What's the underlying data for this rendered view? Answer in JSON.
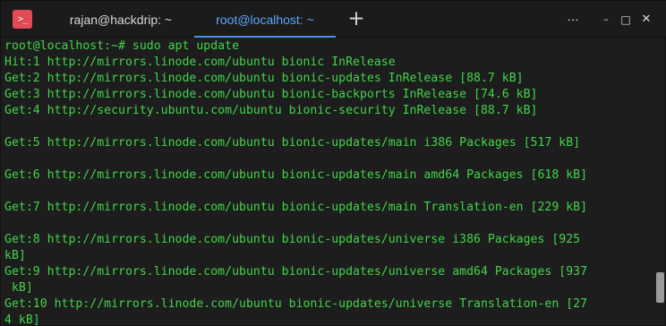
{
  "window": {
    "title_tabs": [
      {
        "label": "rajan@hackdrip: ~",
        "active": false
      },
      {
        "label": "root@localhost: ~",
        "active": true
      }
    ],
    "app_icon": "terminal-icon",
    "icon_glyph": ">_",
    "controls": {
      "new_tab": "+",
      "menu": "⋮",
      "minimize": "–",
      "maximize": "□",
      "close": "✕"
    },
    "colors": {
      "background": "#1d1d1d",
      "terminal_text": "#44d34b",
      "active_tab": "#5aa6ff",
      "app_icon": "#e34a55"
    }
  },
  "terminal": {
    "lines": [
      "root@localhost:~# sudo apt update",
      "Hit:1 http://mirrors.linode.com/ubuntu bionic InRelease",
      "Get:2 http://mirrors.linode.com/ubuntu bionic-updates InRelease [88.7 kB]",
      "Get:3 http://mirrors.linode.com/ubuntu bionic-backports InRelease [74.6 kB]",
      "Get:4 http://security.ubuntu.com/ubuntu bionic-security InRelease [88.7 kB]",
      "",
      "Get:5 http://mirrors.linode.com/ubuntu bionic-updates/main i386 Packages [517 kB]",
      "",
      "Get:6 http://mirrors.linode.com/ubuntu bionic-updates/main amd64 Packages [618 kB]",
      "",
      "Get:7 http://mirrors.linode.com/ubuntu bionic-updates/main Translation-en [229 kB]",
      "",
      "Get:8 http://mirrors.linode.com/ubuntu bionic-updates/universe i386 Packages [925",
      "kB]",
      "Get:9 http://mirrors.linode.com/ubuntu bionic-updates/universe amd64 Packages [937",
      " kB]",
      "Get:10 http://mirrors.linode.com/ubuntu bionic-updates/universe Translation-en [27",
      "4 kB]"
    ]
  },
  "scrollbar": {
    "position": 0.82
  }
}
